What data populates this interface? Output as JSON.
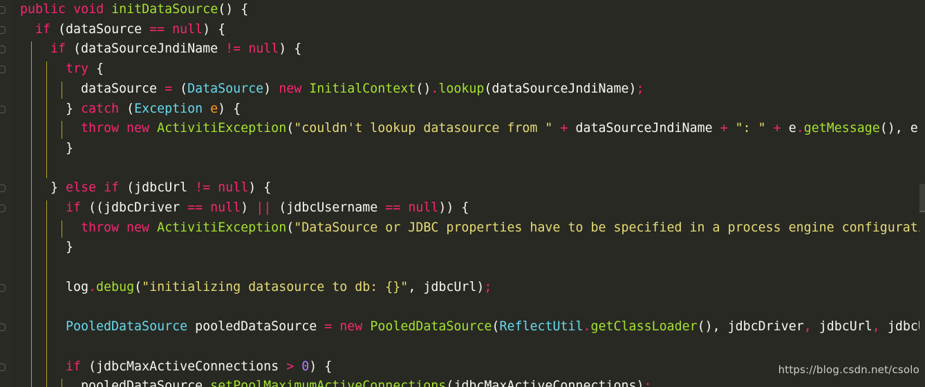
{
  "editor": {
    "lines": [
      {
        "indent": 0,
        "tokens": [
          [
            "kw",
            "public"
          ],
          [
            "pl",
            " "
          ],
          [
            "kw",
            "void"
          ],
          [
            "pl",
            " "
          ],
          [
            "fn",
            "initDataSource"
          ],
          [
            "pl",
            "() {"
          ]
        ]
      },
      {
        "indent": 1,
        "tokens": [
          [
            "kw",
            "if"
          ],
          [
            "pl",
            " (dataSource "
          ],
          [
            "kw",
            "=="
          ],
          [
            "pl",
            " "
          ],
          [
            "kw",
            "null"
          ],
          [
            "pl",
            ") {"
          ]
        ]
      },
      {
        "indent": 2,
        "tokens": [
          [
            "kw",
            "if"
          ],
          [
            "pl",
            " (dataSourceJndiName "
          ],
          [
            "kw",
            "!="
          ],
          [
            "pl",
            " "
          ],
          [
            "kw",
            "null"
          ],
          [
            "pl",
            ") {"
          ]
        ]
      },
      {
        "indent": 3,
        "tokens": [
          [
            "kw",
            "try"
          ],
          [
            "pl",
            " {"
          ]
        ]
      },
      {
        "indent": 4,
        "tokens": [
          [
            "pl",
            "dataSource "
          ],
          [
            "kw",
            "="
          ],
          [
            "pl",
            " ("
          ],
          [
            "ty",
            "DataSource"
          ],
          [
            "pl",
            ") "
          ],
          [
            "kw",
            "new"
          ],
          [
            "pl",
            " "
          ],
          [
            "fn",
            "InitialContext"
          ],
          [
            "pl",
            "()"
          ],
          [
            "kw",
            "."
          ],
          [
            "fn",
            "lookup"
          ],
          [
            "pl",
            "(dataSourceJndiName)"
          ],
          [
            "kw",
            ";"
          ]
        ]
      },
      {
        "indent": 3,
        "tokens": [
          [
            "pl",
            "} "
          ],
          [
            "kw",
            "catch"
          ],
          [
            "pl",
            " ("
          ],
          [
            "ty",
            "Exception"
          ],
          [
            "pl",
            " "
          ],
          [
            "par",
            "e"
          ],
          [
            "pl",
            ") {"
          ]
        ]
      },
      {
        "indent": 4,
        "tokens": [
          [
            "kw",
            "throw"
          ],
          [
            "pl",
            " "
          ],
          [
            "kw",
            "new"
          ],
          [
            "pl",
            " "
          ],
          [
            "fn",
            "ActivitiException"
          ],
          [
            "pl",
            "("
          ],
          [
            "str",
            "\"couldn't lookup datasource from \""
          ],
          [
            "pl",
            " "
          ],
          [
            "kw",
            "+"
          ],
          [
            "pl",
            " dataSourceJndiName "
          ],
          [
            "kw",
            "+"
          ],
          [
            "pl",
            " "
          ],
          [
            "str",
            "\": \""
          ],
          [
            "pl",
            " "
          ],
          [
            "kw",
            "+"
          ],
          [
            "pl",
            " e"
          ],
          [
            "kw",
            "."
          ],
          [
            "fn",
            "getMessage"
          ],
          [
            "pl",
            "(), e);"
          ]
        ]
      },
      {
        "indent": 3,
        "tokens": [
          [
            "pl",
            "}"
          ]
        ]
      },
      {
        "indent": 0,
        "tokens": []
      },
      {
        "indent": 2,
        "tokens": [
          [
            "pl",
            "} "
          ],
          [
            "kw",
            "else"
          ],
          [
            "pl",
            " "
          ],
          [
            "kw",
            "if"
          ],
          [
            "pl",
            " (jdbcUrl "
          ],
          [
            "kw",
            "!="
          ],
          [
            "pl",
            " "
          ],
          [
            "kw",
            "null"
          ],
          [
            "pl",
            ") {"
          ]
        ]
      },
      {
        "indent": 3,
        "tokens": [
          [
            "kw",
            "if"
          ],
          [
            "pl",
            " ((jdbcDriver "
          ],
          [
            "kw",
            "=="
          ],
          [
            "pl",
            " "
          ],
          [
            "kw",
            "null"
          ],
          [
            "pl",
            ") "
          ],
          [
            "kw",
            "||"
          ],
          [
            "pl",
            " (jdbcUsername "
          ],
          [
            "kw",
            "=="
          ],
          [
            "pl",
            " "
          ],
          [
            "kw",
            "null"
          ],
          [
            "pl",
            ")) {"
          ]
        ]
      },
      {
        "indent": 4,
        "tokens": [
          [
            "kw",
            "throw"
          ],
          [
            "pl",
            " "
          ],
          [
            "kw",
            "new"
          ],
          [
            "pl",
            " "
          ],
          [
            "fn",
            "ActivitiException"
          ],
          [
            "pl",
            "("
          ],
          [
            "str",
            "\"DataSource or JDBC properties have to be specified in a process engine configuration\""
          ],
          [
            "pl",
            ");"
          ]
        ]
      },
      {
        "indent": 3,
        "tokens": [
          [
            "pl",
            "}"
          ]
        ]
      },
      {
        "indent": 0,
        "tokens": []
      },
      {
        "indent": 3,
        "tokens": [
          [
            "pl",
            "log"
          ],
          [
            "kw",
            "."
          ],
          [
            "fn",
            "debug"
          ],
          [
            "pl",
            "("
          ],
          [
            "str",
            "\"initializing datasource to db: {}\""
          ],
          [
            "pl",
            ", jdbcUrl)"
          ],
          [
            "kw",
            ";"
          ]
        ]
      },
      {
        "indent": 0,
        "tokens": []
      },
      {
        "indent": 3,
        "tokens": [
          [
            "ty",
            "PooledDataSource"
          ],
          [
            "pl",
            " pooledDataSource "
          ],
          [
            "kw",
            "="
          ],
          [
            "pl",
            " "
          ],
          [
            "kw",
            "new"
          ],
          [
            "pl",
            " "
          ],
          [
            "fn",
            "PooledDataSource"
          ],
          [
            "pl",
            "("
          ],
          [
            "ty",
            "ReflectUtil"
          ],
          [
            "kw",
            "."
          ],
          [
            "fn",
            "getClassLoader"
          ],
          [
            "pl",
            "(), jdbcDriver"
          ],
          [
            "kw",
            ","
          ],
          [
            "pl",
            " jdbcUrl"
          ],
          [
            "kw",
            ","
          ],
          [
            "pl",
            " jdbcUsername, jdbcPassword);"
          ]
        ]
      },
      {
        "indent": 0,
        "tokens": []
      },
      {
        "indent": 3,
        "tokens": [
          [
            "kw",
            "if"
          ],
          [
            "pl",
            " (jdbcMaxActiveConnections "
          ],
          [
            "kw",
            ">"
          ],
          [
            "pl",
            " "
          ],
          [
            "num",
            "0"
          ],
          [
            "pl",
            ") {"
          ]
        ]
      },
      {
        "indent": 4,
        "tokens": [
          [
            "pl",
            "pooledDataSource"
          ],
          [
            "kw",
            "."
          ],
          [
            "fn",
            "setPoolMaximumActiveConnections"
          ],
          [
            "pl",
            "(jdbcMaxActiveConnections)"
          ],
          [
            "kw",
            ";"
          ]
        ]
      }
    ]
  },
  "watermark": "https://blog.csdn.net/csolo",
  "colors": {
    "background": "#282923",
    "keyword": "#f92672",
    "function": "#a6e22e",
    "type": "#66d9ef",
    "string": "#e6db74",
    "number": "#ae81ff",
    "plain": "#f8f8f2",
    "guide": "#b5a52b"
  }
}
